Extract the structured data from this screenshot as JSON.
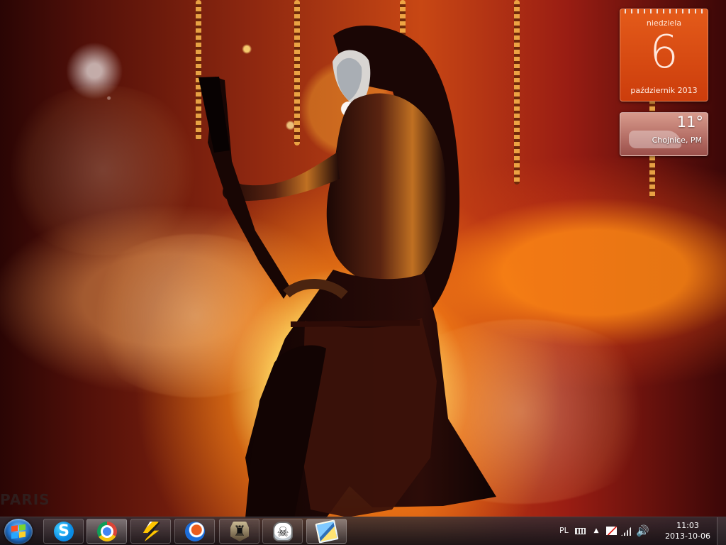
{
  "desktop": {
    "wallpaper_logo": "PARIS"
  },
  "gadgets": {
    "calendar": {
      "day_name": "niedziela",
      "date": "6",
      "month_year": "październik 2013"
    },
    "weather": {
      "temperature": "11°",
      "location": "Chojnice, PM"
    }
  },
  "taskbar": {
    "items": [
      {
        "name": "Start",
        "icon": "windows-icon"
      },
      {
        "name": "Skype",
        "icon": "skype-icon"
      },
      {
        "name": "Google Chrome",
        "icon": "chrome-icon"
      },
      {
        "name": "Lightning app",
        "icon": "bolt-icon"
      },
      {
        "name": "Game launcher",
        "icon": "game-icon"
      },
      {
        "name": "World of Tanks",
        "icon": "tank-icon"
      },
      {
        "name": "Skull app",
        "icon": "skull-icon"
      },
      {
        "name": "Photos",
        "icon": "photos-icon"
      }
    ],
    "tray": {
      "language": "PL",
      "time": "11:03",
      "date": "2013-10-06"
    }
  },
  "colors": {
    "calendar": "#d9480f",
    "weather": "#bd7068",
    "taskbar": "#2a2328"
  }
}
